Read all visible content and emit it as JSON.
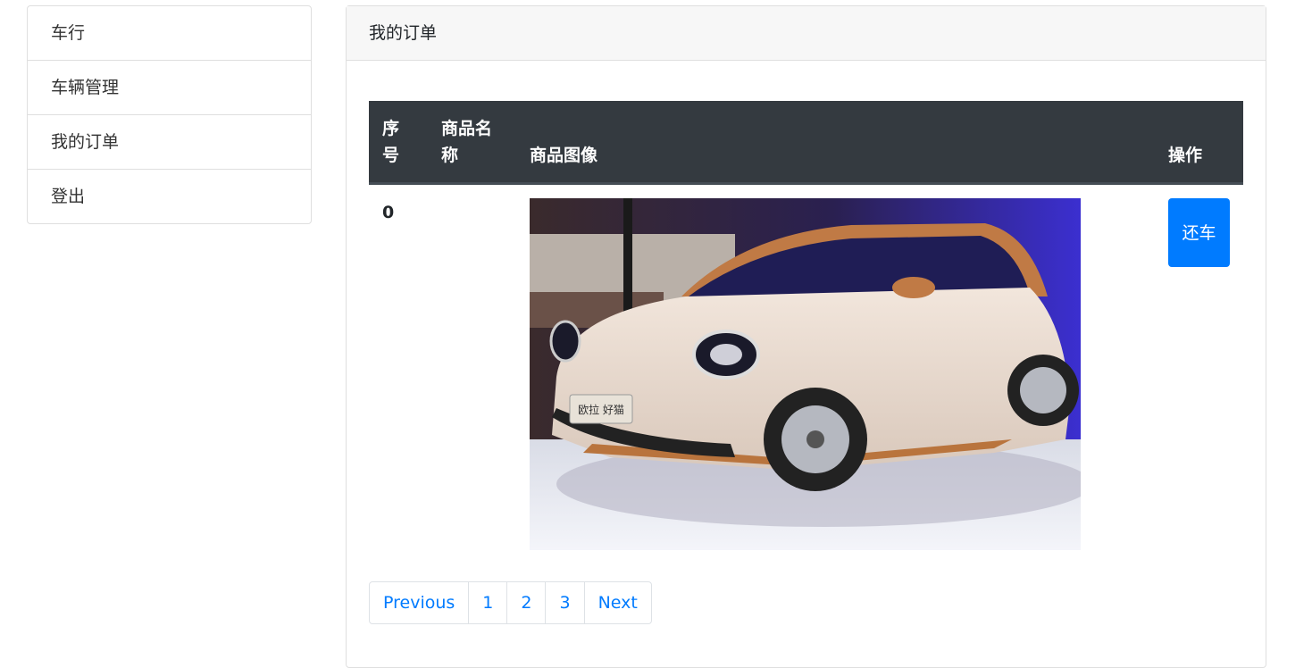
{
  "sidebar": {
    "items": [
      {
        "label": "车行"
      },
      {
        "label": "车辆管理"
      },
      {
        "label": "我的订单"
      },
      {
        "label": "登出"
      }
    ]
  },
  "card": {
    "title": "我的订单"
  },
  "table": {
    "headers": [
      "序号",
      "商品名称",
      "商品图像",
      "操作"
    ],
    "rows": [
      {
        "index": "0",
        "name": "",
        "image": "car-photo",
        "action": "还车"
      }
    ]
  },
  "pagination": {
    "previous": "Previous",
    "pages": [
      "1",
      "2",
      "3"
    ],
    "next": "Next"
  },
  "image_label": {
    "brand_plate": "欧拉 好猫"
  },
  "colors": {
    "accent": "#007bff",
    "table_header_bg": "#343a40",
    "card_header_bg": "#f7f7f7"
  }
}
